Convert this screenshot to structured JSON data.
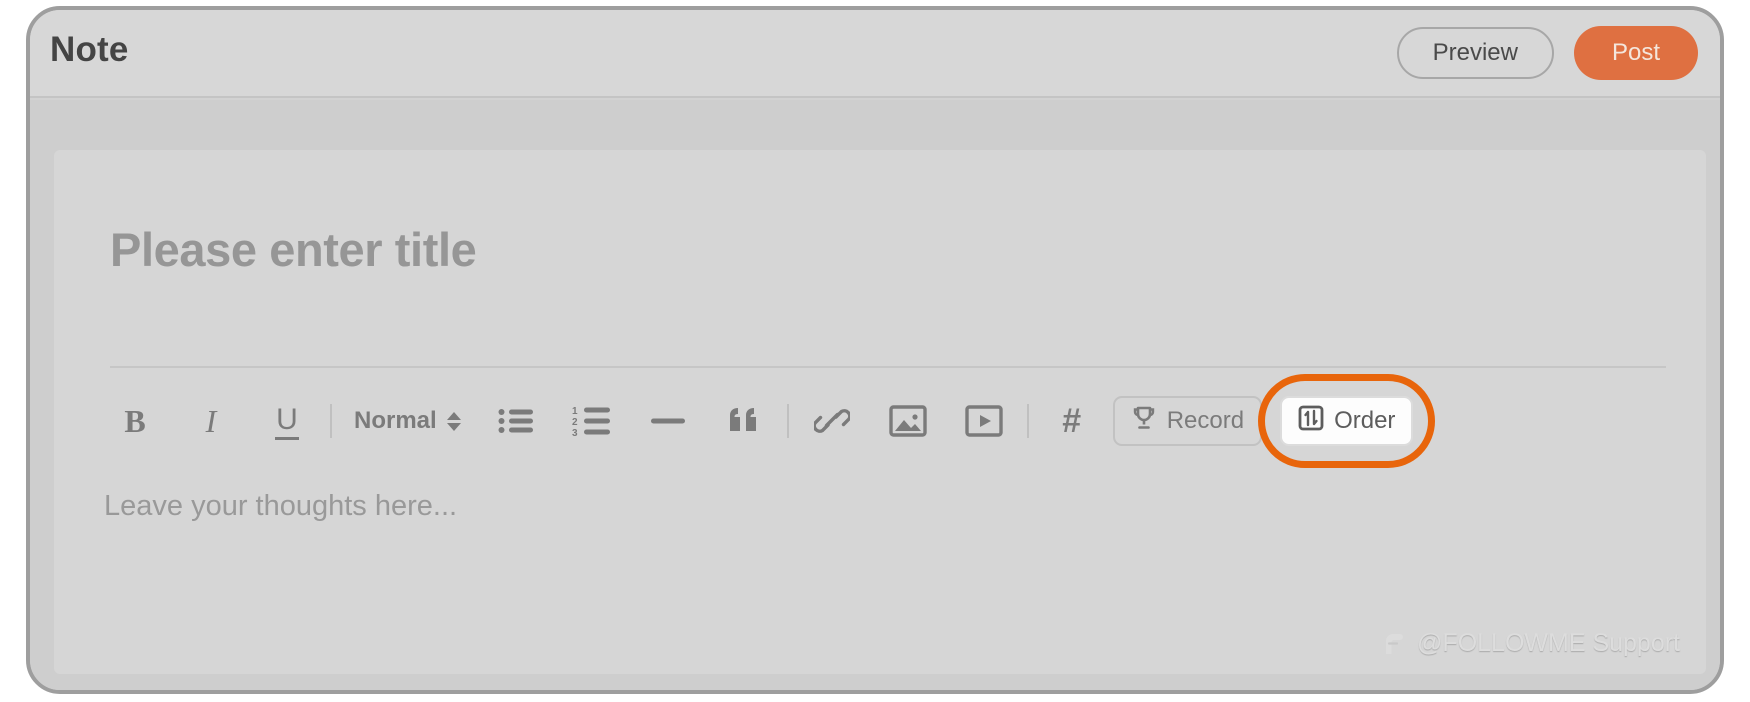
{
  "header": {
    "title": "Note",
    "preview_label": "Preview",
    "post_label": "Post",
    "post_color": "#df7041"
  },
  "editor": {
    "title_placeholder": "Please enter title",
    "content_placeholder": "Leave your thoughts here..."
  },
  "toolbar": {
    "bold": "B",
    "italic": "I",
    "underline": "U",
    "style_label": "Normal",
    "hash": "#",
    "record_label": "Record",
    "order_label": "Order",
    "icons": [
      "bold-icon",
      "italic-icon",
      "underline-icon",
      "paragraph-style-select",
      "bullet-list-icon",
      "numbered-list-icon",
      "horizontal-rule-icon",
      "blockquote-icon",
      "link-icon",
      "image-icon",
      "video-icon",
      "hashtag-icon",
      "trophy-icon",
      "order-icon"
    ]
  },
  "highlight": {
    "target": "order-button",
    "ring_color": "#e8650b"
  },
  "watermark": {
    "text": "@FOLLOWME Support"
  }
}
